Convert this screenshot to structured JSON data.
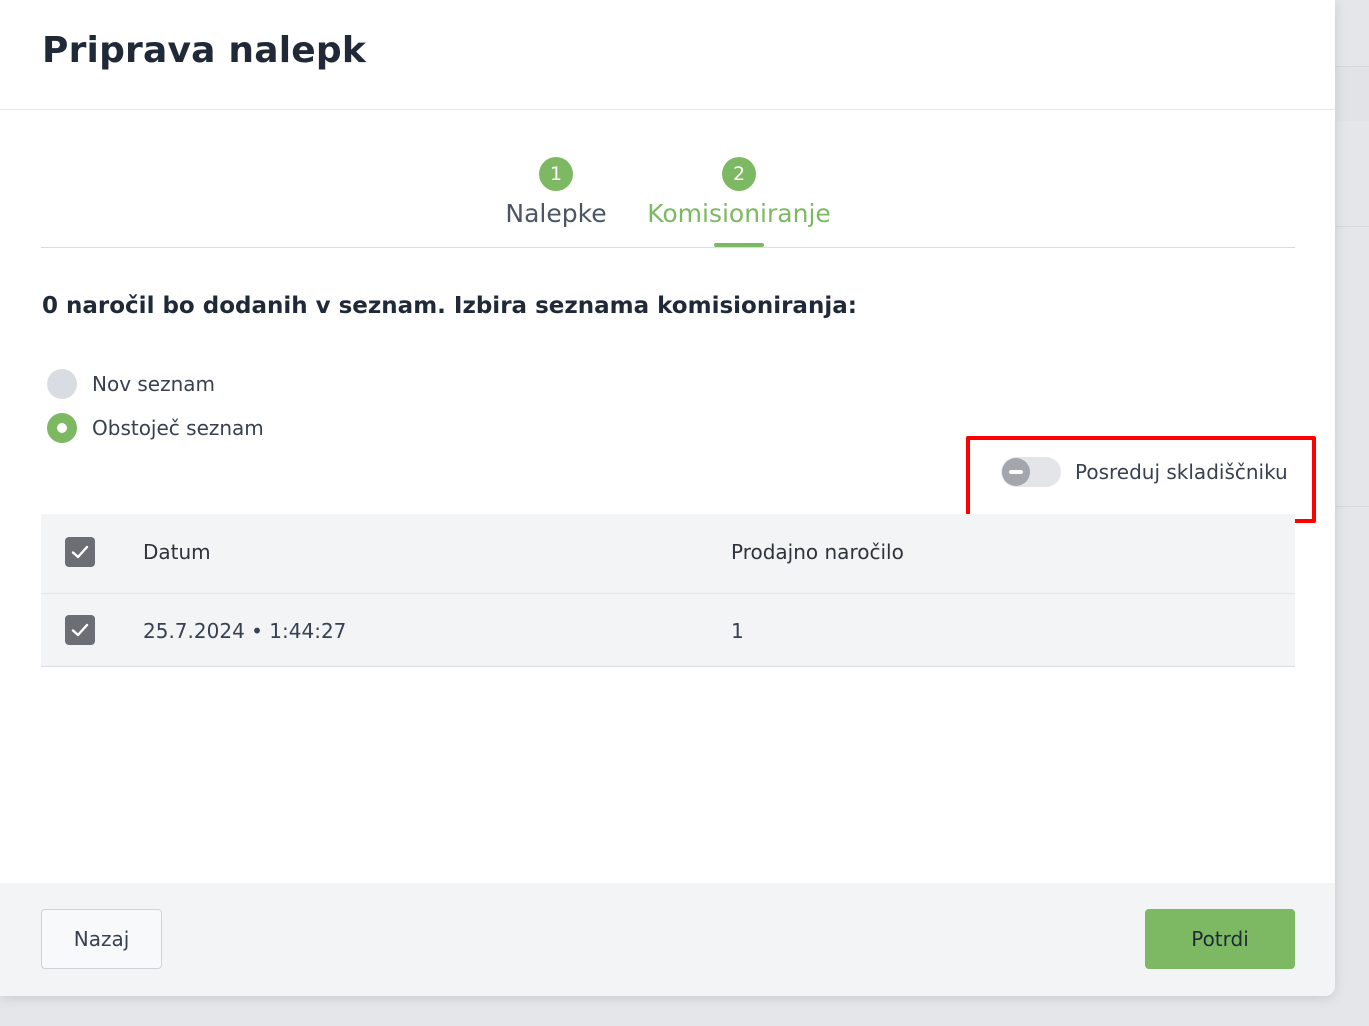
{
  "modal": {
    "title": "Priprava nalepk"
  },
  "stepper": {
    "steps": [
      {
        "number": "1",
        "label": "Nalepke",
        "active": false
      },
      {
        "number": "2",
        "label": "Komisioniranje",
        "active": true
      }
    ]
  },
  "content": {
    "intro": "0 naročil bo dodanih v seznam. Izbira seznama komisioniranja:",
    "radio_options": [
      {
        "label": "Nov seznam",
        "checked": false
      },
      {
        "label": "Obstoječ seznam",
        "checked": true
      }
    ],
    "toggle": {
      "label": "Posreduj skladiščniku",
      "on": false
    }
  },
  "table": {
    "columns": [
      "Datum",
      "Prodajno naročilo"
    ],
    "header_checked": true,
    "rows": [
      {
        "checked": true,
        "date": "25.7.2024 • 1:44:27",
        "order": "1"
      }
    ]
  },
  "footer": {
    "back_label": "Nazaj",
    "confirm_label": "Potrdi"
  },
  "colors": {
    "accent": "#7cb962",
    "annotation": "#ff0000"
  }
}
